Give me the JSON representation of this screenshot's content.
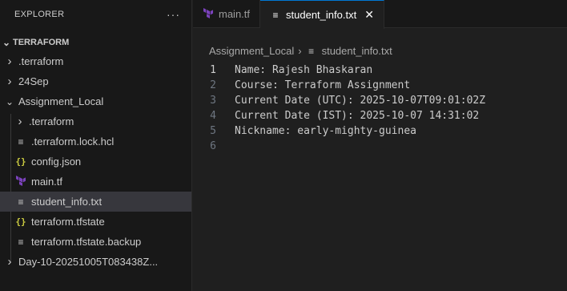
{
  "sidebar": {
    "title": "EXPLORER",
    "more": "···",
    "root": "TERRAFORM",
    "items": [
      {
        "label": ".terraform",
        "type": "folder",
        "expanded": false,
        "indent": 0
      },
      {
        "label": "24Sep",
        "type": "folder",
        "expanded": false,
        "indent": 0
      },
      {
        "label": "Assignment_Local",
        "type": "folder",
        "expanded": true,
        "indent": 0
      },
      {
        "label": ".terraform",
        "type": "folder",
        "expanded": false,
        "indent": 1
      },
      {
        "label": ".terraform.lock.hcl",
        "type": "txt",
        "indent": 1
      },
      {
        "label": "config.json",
        "type": "json",
        "indent": 1
      },
      {
        "label": "main.tf",
        "type": "tf",
        "indent": 1
      },
      {
        "label": "student_info.txt",
        "type": "txt",
        "indent": 1,
        "selected": true
      },
      {
        "label": "terraform.tfstate",
        "type": "json",
        "indent": 1
      },
      {
        "label": "terraform.tfstate.backup",
        "type": "txt",
        "indent": 1
      },
      {
        "label": "Day-10-20251005T083438Z...",
        "type": "folder",
        "expanded": false,
        "indent": 0
      }
    ]
  },
  "tabs": [
    {
      "label": "main.tf",
      "icon": "terraform-icon",
      "active": false
    },
    {
      "label": "student_info.txt",
      "icon": "text-file-icon",
      "active": true,
      "close": "✕"
    }
  ],
  "breadcrumb": {
    "folder": "Assignment_Local",
    "sep": "›",
    "file": "student_info.txt"
  },
  "editor": {
    "current_line": 1,
    "lines": [
      {
        "n": "1",
        "text": "Name: Rajesh Bhaskaran"
      },
      {
        "n": "2",
        "text": "Course: Terraform Assignment"
      },
      {
        "n": "3",
        "text": "Current Date (UTC): 2025-10-07T09:01:02Z"
      },
      {
        "n": "4",
        "text": "Current Date (IST): 2025-10-07 14:31:02"
      },
      {
        "n": "5",
        "text": "Nickname: early-mighty-guinea"
      },
      {
        "n": "6",
        "text": ""
      }
    ]
  },
  "colors": {
    "terraform": "#7b42bc",
    "json": "#cbcb41",
    "accent": "#0078d4"
  }
}
